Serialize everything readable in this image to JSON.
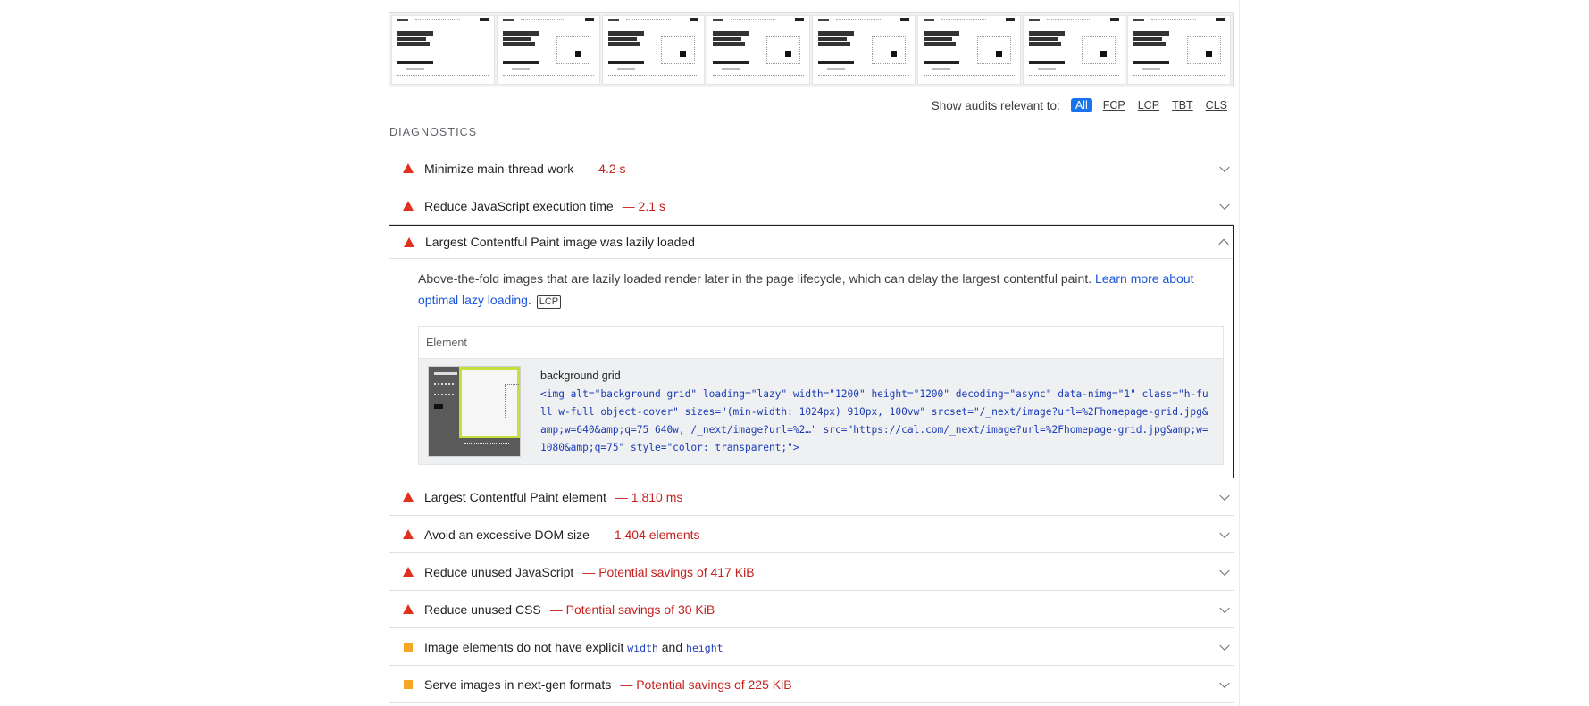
{
  "filter": {
    "label": "Show audits relevant to:",
    "chips": [
      "All",
      "FCP",
      "LCP",
      "TBT",
      "CLS"
    ],
    "active": "All"
  },
  "diagnostics": {
    "section_title": "DIAGNOSTICS",
    "audits": [
      {
        "id": "main-thread",
        "severity": "fail",
        "title": "Minimize main-thread work",
        "display": "— 4.2 s"
      },
      {
        "id": "js-exec",
        "severity": "fail",
        "title": "Reduce JavaScript execution time",
        "display": "— 2.1 s"
      },
      {
        "id": "lcp-lazy",
        "severity": "fail",
        "title": "Largest Contentful Paint image was lazily loaded",
        "display": "",
        "expanded": true
      },
      {
        "id": "lcp-element",
        "severity": "fail",
        "title": "Largest Contentful Paint element",
        "display": "— 1,810 ms"
      },
      {
        "id": "dom-size",
        "severity": "fail",
        "title": "Avoid an excessive DOM size",
        "display": "— 1,404 elements"
      },
      {
        "id": "unused-js",
        "severity": "fail",
        "title": "Reduce unused JavaScript",
        "display": "— Potential savings of 417 KiB"
      },
      {
        "id": "unused-css",
        "severity": "fail",
        "title": "Reduce unused CSS",
        "display": "— Potential savings of 30 KiB"
      },
      {
        "id": "explicit-size",
        "severity": "average",
        "title_prefix": "Image elements do not have explicit",
        "code1": "width",
        "and": "and",
        "code2": "height"
      },
      {
        "id": "next-gen",
        "severity": "average",
        "title": "Serve images in next-gen formats",
        "display": "— Potential savings of 225 KiB"
      }
    ]
  },
  "lcp_lazy_detail": {
    "description": "Above-the-fold images that are lazily loaded render later in the page lifecycle, which can delay the largest contentful paint.",
    "link_text": "Learn more about optimal lazy loading",
    "period": ".",
    "badge": "LCP",
    "table_header": "Element",
    "element_label": "background grid",
    "snippet": "<img alt=\"background grid\" loading=\"lazy\" width=\"1200\" height=\"1200\" decoding=\"async\" data-nimg=\"1\" class=\"h-full w-full object-cover\" sizes=\"(min-width: 1024px) 910px, 100vw\" srcset=\"/_next/image?url=%2Fhomepage-grid.jpg&amp;w=640&amp;q=75 640w, /_next/image?url=%2…\" src=\"https://cal.com/_next/image?url=%2Fhomepage-grid.jpg&amp;w=1080&amp;q=75\" style=\"color: transparent;\">"
  },
  "colors": {
    "fail": "#e0301e",
    "average": "#f5a623",
    "display": "#c5221f",
    "link": "#1a56db",
    "chip_active": "#1a73e8"
  }
}
